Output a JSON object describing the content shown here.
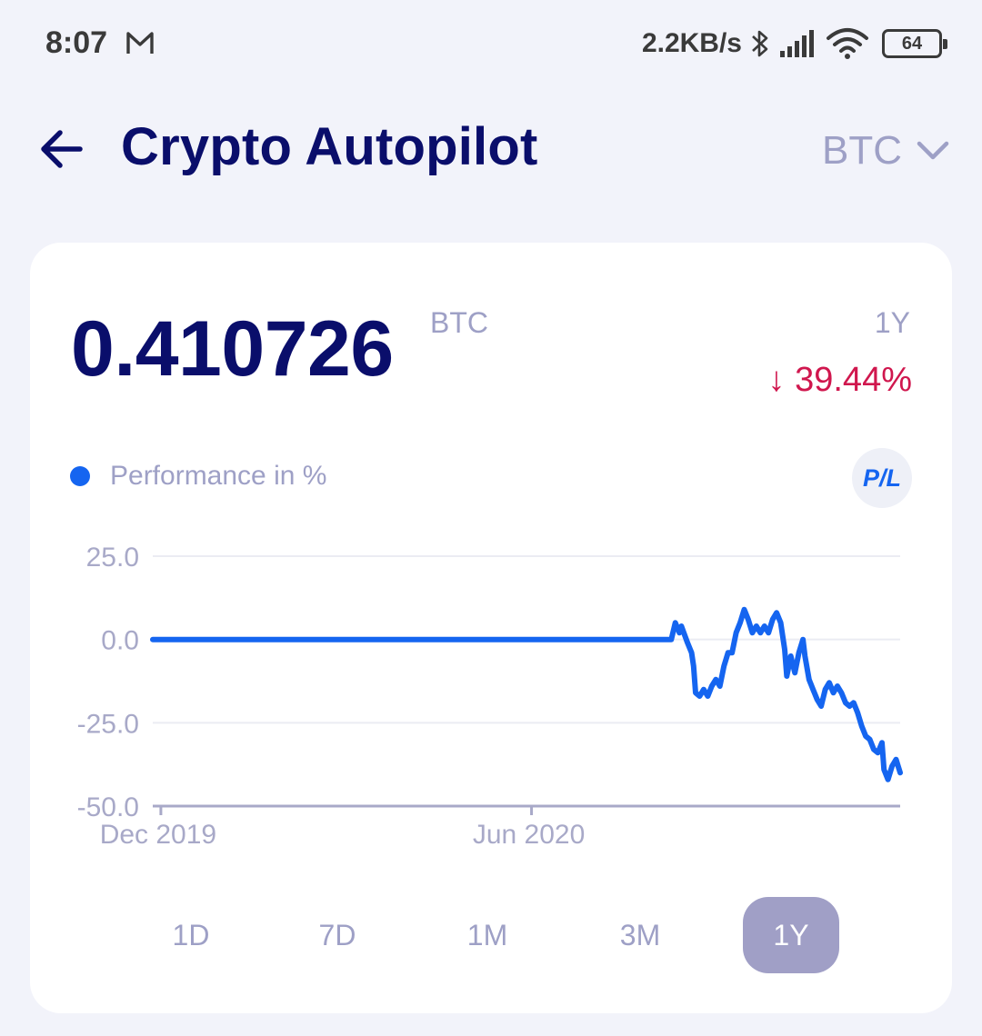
{
  "status_bar": {
    "time": "8:07",
    "mail_icon": "gmail-icon",
    "speed": "2.2KB/s",
    "battery": "64"
  },
  "header": {
    "title": "Crypto Autopilot",
    "back_icon": "arrow-left-icon",
    "currency": "BTC",
    "currency_icon": "chevron-down-icon"
  },
  "summary": {
    "balance": "0.410726",
    "unit": "BTC",
    "period": "1Y",
    "change": "↓ 39.44%",
    "change_color": "#d0174e"
  },
  "legend": {
    "label": "Performance in %",
    "color": "#1565f0",
    "pl_button": "P/L"
  },
  "range_tabs": [
    {
      "label": "1D",
      "active": false
    },
    {
      "label": "7D",
      "active": false
    },
    {
      "label": "1M",
      "active": false
    },
    {
      "label": "3M",
      "active": false
    },
    {
      "label": "1Y",
      "active": true
    }
  ],
  "chart_data": {
    "type": "line",
    "ylim": [
      -50,
      25
    ],
    "y_ticks": [
      25.0,
      0.0,
      -25.0,
      -50.0
    ],
    "y_tick_labels": [
      "25.0",
      "0.0",
      "-25.0",
      "-50.0"
    ],
    "x_ticks": [
      {
        "label": "Dec 2019",
        "date": "2019-12-01"
      },
      {
        "label": "Jun 2020",
        "date": "2020-06-01"
      }
    ],
    "x_range": [
      "2019-11-27",
      "2020-11-30"
    ],
    "grid": true,
    "series": [
      {
        "color": "#1565f0",
        "points": [
          [
            "2019-11-27",
            0
          ],
          [
            "2020-08-09",
            0
          ],
          [
            "2020-08-11",
            5
          ],
          [
            "2020-08-13",
            2
          ],
          [
            "2020-08-14",
            4
          ],
          [
            "2020-08-17",
            -1
          ],
          [
            "2020-08-19",
            -4
          ],
          [
            "2020-08-20",
            -8
          ],
          [
            "2020-08-21",
            -16
          ],
          [
            "2020-08-23",
            -17
          ],
          [
            "2020-08-25",
            -15
          ],
          [
            "2020-08-27",
            -17
          ],
          [
            "2020-08-29",
            -14
          ],
          [
            "2020-08-31",
            -12
          ],
          [
            "2020-09-02",
            -14
          ],
          [
            "2020-09-04",
            -8
          ],
          [
            "2020-09-06",
            -4
          ],
          [
            "2020-09-08",
            -4
          ],
          [
            "2020-09-10",
            2
          ],
          [
            "2020-09-12",
            5
          ],
          [
            "2020-09-14",
            9
          ],
          [
            "2020-09-16",
            6
          ],
          [
            "2020-09-18",
            2
          ],
          [
            "2020-09-20",
            4
          ],
          [
            "2020-09-22",
            2
          ],
          [
            "2020-09-24",
            4
          ],
          [
            "2020-09-26",
            2
          ],
          [
            "2020-09-28",
            6
          ],
          [
            "2020-09-30",
            8
          ],
          [
            "2020-10-02",
            5
          ],
          [
            "2020-10-04",
            -3
          ],
          [
            "2020-10-05",
            -11
          ],
          [
            "2020-10-07",
            -5
          ],
          [
            "2020-10-09",
            -10
          ],
          [
            "2020-10-11",
            -4
          ],
          [
            "2020-10-13",
            0
          ],
          [
            "2020-10-14",
            -5
          ],
          [
            "2020-10-16",
            -12
          ],
          [
            "2020-10-18",
            -15
          ],
          [
            "2020-10-20",
            -18
          ],
          [
            "2020-10-22",
            -20
          ],
          [
            "2020-10-24",
            -15
          ],
          [
            "2020-10-26",
            -13
          ],
          [
            "2020-10-28",
            -16
          ],
          [
            "2020-10-30",
            -14
          ],
          [
            "2020-11-01",
            -16
          ],
          [
            "2020-11-03",
            -19
          ],
          [
            "2020-11-05",
            -20
          ],
          [
            "2020-11-07",
            -19
          ],
          [
            "2020-11-09",
            -22
          ],
          [
            "2020-11-11",
            -26
          ],
          [
            "2020-11-13",
            -29
          ],
          [
            "2020-11-15",
            -30
          ],
          [
            "2020-11-17",
            -33
          ],
          [
            "2020-11-19",
            -34
          ],
          [
            "2020-11-21",
            -31
          ],
          [
            "2020-11-22",
            -39
          ],
          [
            "2020-11-24",
            -42
          ],
          [
            "2020-11-26",
            -38
          ],
          [
            "2020-11-28",
            -36
          ],
          [
            "2020-11-30",
            -40
          ]
        ]
      }
    ]
  }
}
